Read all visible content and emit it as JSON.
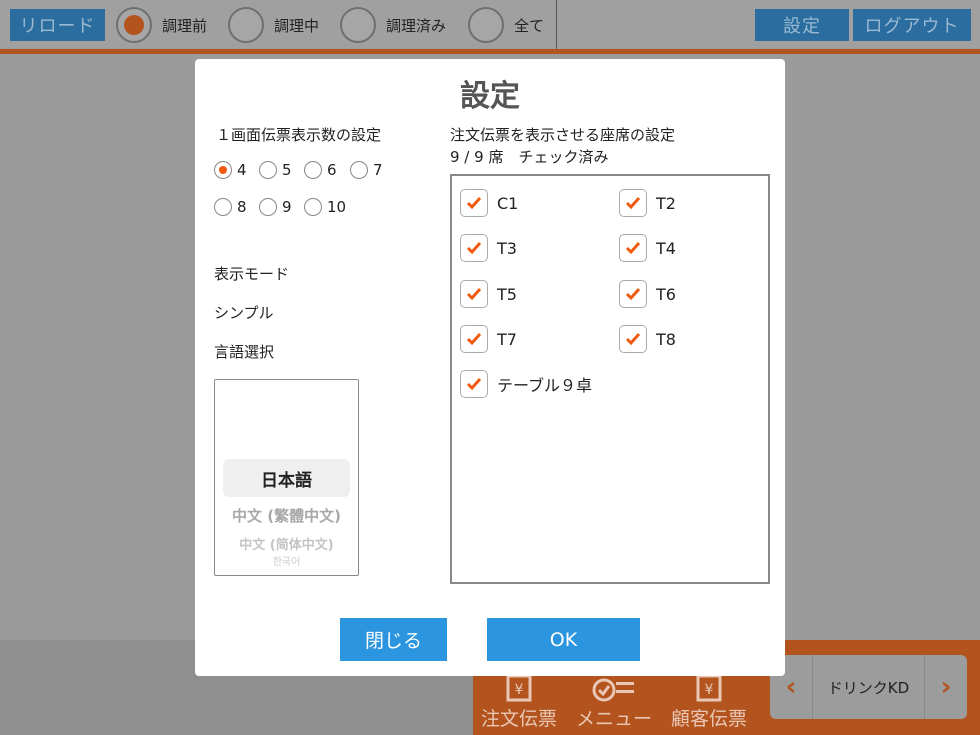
{
  "topbar": {
    "reload_label": "リロード",
    "filters": [
      {
        "label": "調理前",
        "selected": true
      },
      {
        "label": "調理中",
        "selected": false
      },
      {
        "label": "調理済み",
        "selected": false
      },
      {
        "label": "全て",
        "selected": false
      }
    ],
    "settings_label": "設定",
    "logout_label": "ログアウト"
  },
  "bottombar": {
    "tools": [
      {
        "label": "注文伝票",
        "icon": "yen-receipt-icon"
      },
      {
        "label": "メニュー",
        "icon": "check-list-icon"
      },
      {
        "label": "顧客伝票",
        "icon": "yen-receipt-icon"
      }
    ],
    "drink_label": "ドリンクKD",
    "prev_icon": "chevron-left-icon",
    "next_icon": "chevron-right-icon"
  },
  "modal": {
    "title": "設定",
    "slip_count": {
      "label": "１画面伝票表示数の設定",
      "options": [
        "4",
        "5",
        "6",
        "7",
        "8",
        "9",
        "10"
      ],
      "selected": "4"
    },
    "display_mode": {
      "label": "表示モード",
      "value": "シンプル"
    },
    "language": {
      "label": "言語選択",
      "selected": "日本語",
      "options": [
        "中文 (繁體中文)",
        "中文 (简体中文)",
        "한국어"
      ]
    },
    "seats": {
      "label": "注文伝票を表示させる座席の設定",
      "summary": "9 / 9 席　チェック済み",
      "items": [
        {
          "name": "C1",
          "checked": true
        },
        {
          "name": "T2",
          "checked": true
        },
        {
          "name": "T3",
          "checked": true
        },
        {
          "name": "T4",
          "checked": true
        },
        {
          "name": "T5",
          "checked": true
        },
        {
          "name": "T6",
          "checked": true
        },
        {
          "name": "T7",
          "checked": true
        },
        {
          "name": "T8",
          "checked": true
        },
        {
          "name": "テーブル９卓",
          "checked": true
        }
      ]
    },
    "close_label": "閉じる",
    "ok_label": "OK"
  },
  "colors": {
    "accent": "#f05a0f",
    "button_blue": "#2b95e0",
    "overlay_orange": "#b3541e"
  }
}
